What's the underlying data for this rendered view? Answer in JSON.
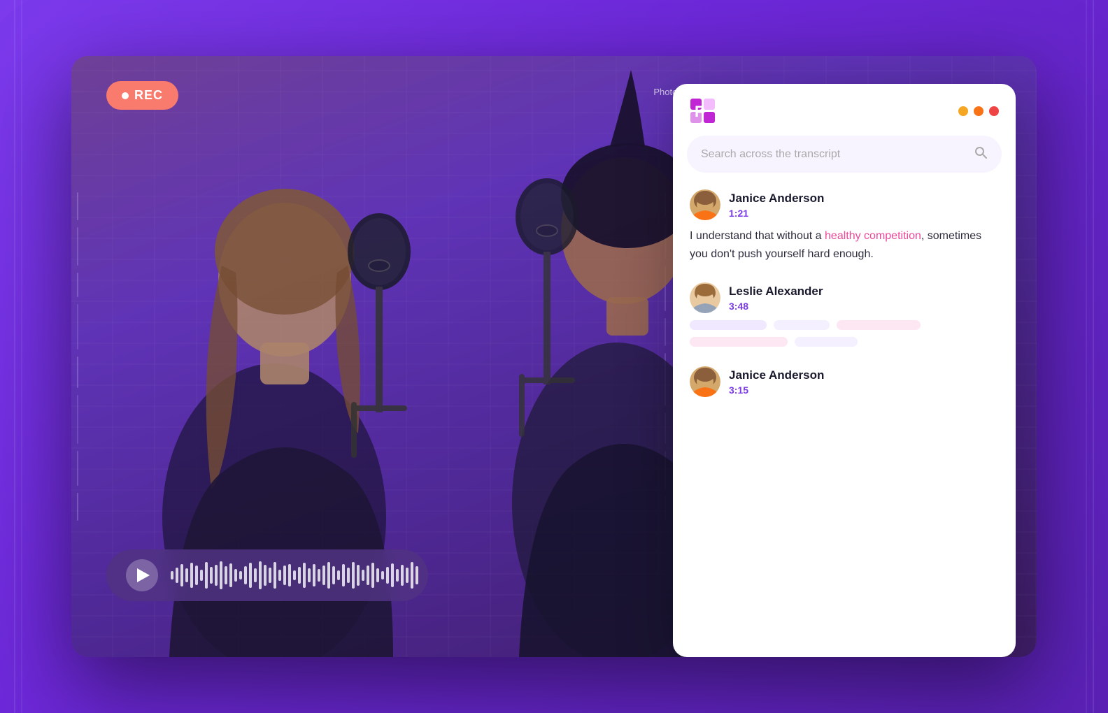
{
  "background": {
    "gradient_from": "#7c3aed",
    "gradient_to": "#5b21b6"
  },
  "rec_badge": {
    "label": "REC"
  },
  "photo_credit": "Photo by @george-milton",
  "audio_player": {
    "play_button_label": "Play",
    "wave_bars": [
      12,
      20,
      30,
      22,
      35,
      28,
      18,
      36,
      24,
      30,
      38,
      26,
      32,
      20,
      14,
      26,
      34,
      22,
      38,
      30,
      24,
      36,
      18,
      28,
      32
    ]
  },
  "transcript_panel": {
    "logo_alt": "Transcript App Logo",
    "traffic_lights": [
      "yellow",
      "orange",
      "red"
    ],
    "search": {
      "placeholder": "Search across the transcript",
      "icon": "search"
    },
    "entries": [
      {
        "speaker": "Janice Anderson",
        "time": "1:21",
        "text_before_highlight": "I understand that without a ",
        "highlight": "healthy competition",
        "text_after_highlight": ", sometimes you don't push yourself hard enough.",
        "avatar_type": "janice"
      },
      {
        "speaker": "Leslie Alexander",
        "time": "3:48",
        "text": "",
        "avatar_type": "leslie",
        "has_skeleton": true
      },
      {
        "speaker": "Janice Anderson",
        "time": "3:15",
        "text": "",
        "avatar_type": "janice",
        "has_skeleton": false
      }
    ]
  }
}
